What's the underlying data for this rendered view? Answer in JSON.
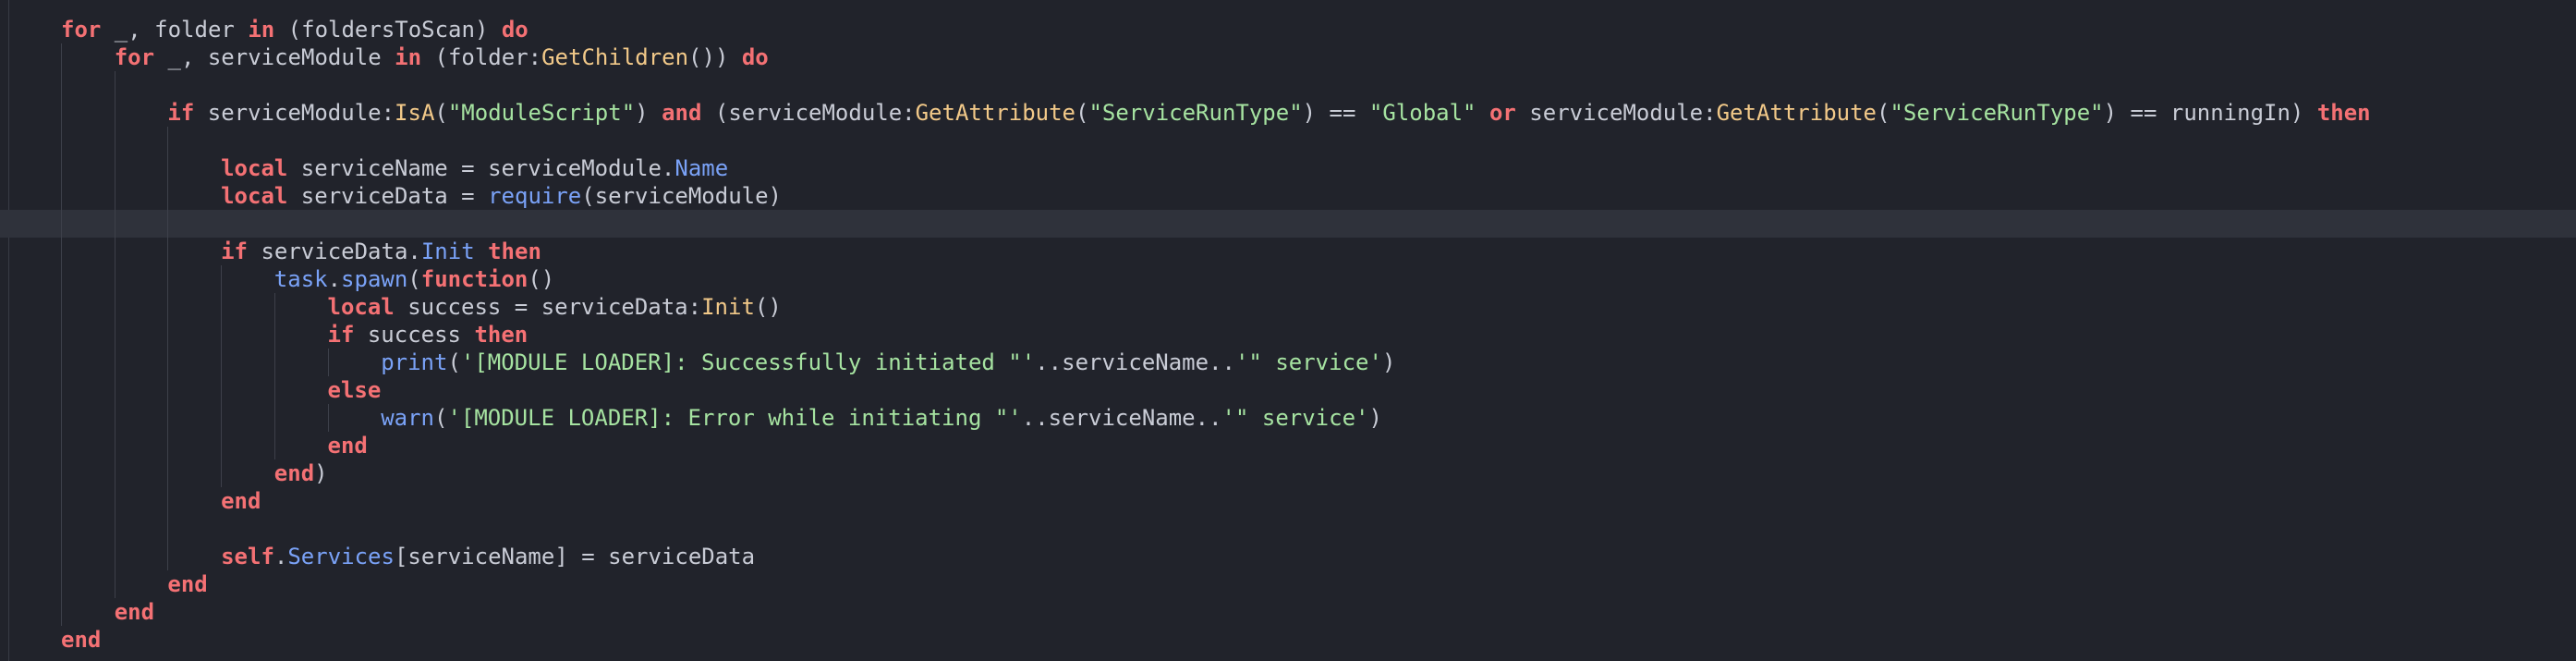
{
  "editor": {
    "lines": [
      {
        "indent": 0,
        "guides": 0,
        "tokens": [
          [
            "kw",
            "for"
          ],
          [
            "plain",
            " _, folder "
          ],
          [
            "kw",
            "in"
          ],
          [
            "plain",
            " (foldersToScan) "
          ],
          [
            "kw",
            "do"
          ]
        ]
      },
      {
        "indent": 1,
        "guides": 1,
        "tokens": [
          [
            "kw",
            "for"
          ],
          [
            "plain",
            " _, serviceModule "
          ],
          [
            "kw",
            "in"
          ],
          [
            "plain",
            " (folder:"
          ],
          [
            "fn",
            "GetChildren"
          ],
          [
            "plain",
            "()) "
          ],
          [
            "kw",
            "do"
          ]
        ]
      },
      {
        "indent": 2,
        "guides": 2,
        "tokens": []
      },
      {
        "indent": 2,
        "guides": 2,
        "tokens": [
          [
            "kw",
            "if"
          ],
          [
            "plain",
            " serviceModule:"
          ],
          [
            "fn",
            "IsA"
          ],
          [
            "plain",
            "("
          ],
          [
            "str",
            "\"ModuleScript\""
          ],
          [
            "plain",
            ") "
          ],
          [
            "kw",
            "and"
          ],
          [
            "plain",
            " (serviceModule:"
          ],
          [
            "fn",
            "GetAttribute"
          ],
          [
            "plain",
            "("
          ],
          [
            "str",
            "\"ServiceRunType\""
          ],
          [
            "plain",
            ") == "
          ],
          [
            "str",
            "\"Global\""
          ],
          [
            "plain",
            " "
          ],
          [
            "kw",
            "or"
          ],
          [
            "plain",
            " serviceModule:"
          ],
          [
            "fn",
            "GetAttribute"
          ],
          [
            "plain",
            "("
          ],
          [
            "str",
            "\"ServiceRunType\""
          ],
          [
            "plain",
            ") == runningIn) "
          ],
          [
            "kw",
            "then"
          ]
        ]
      },
      {
        "indent": 3,
        "guides": 3,
        "tokens": []
      },
      {
        "indent": 3,
        "guides": 3,
        "tokens": [
          [
            "kw",
            "local"
          ],
          [
            "plain",
            " serviceName = serviceModule."
          ],
          [
            "prop",
            "Name"
          ]
        ]
      },
      {
        "indent": 3,
        "guides": 3,
        "tokens": [
          [
            "kw",
            "local"
          ],
          [
            "plain",
            " serviceData = "
          ],
          [
            "prop",
            "require"
          ],
          [
            "plain",
            "(serviceModule)"
          ]
        ]
      },
      {
        "indent": 3,
        "guides": 3,
        "tokens": [],
        "current": true
      },
      {
        "indent": 3,
        "guides": 3,
        "tokens": [
          [
            "kw",
            "if"
          ],
          [
            "plain",
            " serviceData."
          ],
          [
            "prop",
            "Init"
          ],
          [
            "plain",
            " "
          ],
          [
            "kw",
            "then"
          ]
        ]
      },
      {
        "indent": 4,
        "guides": 4,
        "tokens": [
          [
            "prop",
            "task"
          ],
          [
            "plain",
            "."
          ],
          [
            "prop",
            "spawn"
          ],
          [
            "plain",
            "("
          ],
          [
            "kw",
            "function"
          ],
          [
            "plain",
            "()"
          ]
        ]
      },
      {
        "indent": 5,
        "guides": 5,
        "tokens": [
          [
            "kw",
            "local"
          ],
          [
            "plain",
            " success = serviceData:"
          ],
          [
            "fn",
            "Init"
          ],
          [
            "plain",
            "()"
          ]
        ]
      },
      {
        "indent": 5,
        "guides": 5,
        "tokens": [
          [
            "kw",
            "if"
          ],
          [
            "plain",
            " success "
          ],
          [
            "kw",
            "then"
          ]
        ]
      },
      {
        "indent": 6,
        "guides": 6,
        "tokens": [
          [
            "prop",
            "print"
          ],
          [
            "plain",
            "("
          ],
          [
            "str",
            "'[MODULE LOADER]: Successfully initiated \"'"
          ],
          [
            "plain",
            ".."
          ],
          [
            "plain",
            "serviceName"
          ],
          [
            "plain",
            ".."
          ],
          [
            "str",
            "'\" service'"
          ],
          [
            "plain",
            ")"
          ]
        ]
      },
      {
        "indent": 5,
        "guides": 5,
        "tokens": [
          [
            "kw",
            "else"
          ]
        ]
      },
      {
        "indent": 6,
        "guides": 6,
        "tokens": [
          [
            "prop",
            "warn"
          ],
          [
            "plain",
            "("
          ],
          [
            "str",
            "'[MODULE LOADER]: Error while initiating \"'"
          ],
          [
            "plain",
            ".."
          ],
          [
            "plain",
            "serviceName"
          ],
          [
            "plain",
            ".."
          ],
          [
            "str",
            "'\" service'"
          ],
          [
            "plain",
            ")"
          ]
        ]
      },
      {
        "indent": 5,
        "guides": 5,
        "tokens": [
          [
            "kw",
            "end"
          ]
        ]
      },
      {
        "indent": 4,
        "guides": 4,
        "tokens": [
          [
            "kw",
            "end"
          ],
          [
            "plain",
            ")"
          ]
        ]
      },
      {
        "indent": 3,
        "guides": 3,
        "tokens": [
          [
            "kw",
            "end"
          ]
        ]
      },
      {
        "indent": 3,
        "guides": 3,
        "tokens": []
      },
      {
        "indent": 3,
        "guides": 3,
        "tokens": [
          [
            "kw",
            "self"
          ],
          [
            "plain",
            "."
          ],
          [
            "prop",
            "Services"
          ],
          [
            "plain",
            "[serviceName] = serviceData"
          ]
        ]
      },
      {
        "indent": 2,
        "guides": 2,
        "tokens": [
          [
            "kw",
            "end"
          ]
        ]
      },
      {
        "indent": 1,
        "guides": 1,
        "tokens": [
          [
            "kw",
            "end"
          ]
        ]
      },
      {
        "indent": 0,
        "guides": 0,
        "tokens": [
          [
            "kw",
            "end"
          ]
        ]
      }
    ]
  },
  "colors": {
    "background": "#21232b",
    "current_line": "#2f323b",
    "keyword": "#f47174",
    "plain": "#c9ccd6",
    "function": "#f2c989",
    "string": "#a6e3a1",
    "property": "#7aa2f7"
  }
}
